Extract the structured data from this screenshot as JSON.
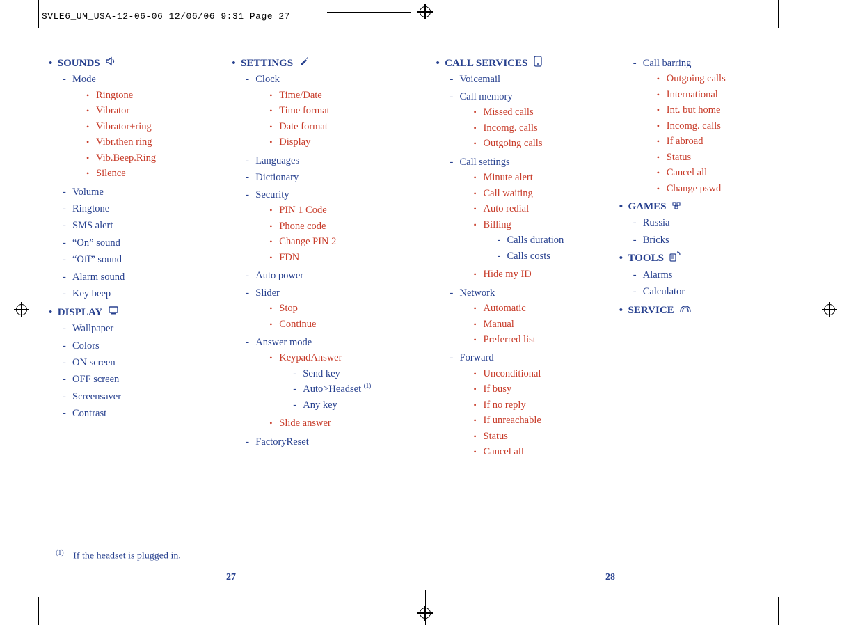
{
  "header_line": "SVLE6_UM_USA-12-06-06  12/06/06  9:31  Page 27",
  "footnote": {
    "marker": "(1)",
    "text": "If the headset is plugged in."
  },
  "page_num_left": "27",
  "page_num_right": "28",
  "menus": {
    "sounds": {
      "label": "SOUNDS",
      "mode": "Mode",
      "mode_items": [
        "Ringtone",
        "Vibrator",
        "Vibrator+ring",
        "Vibr.then ring",
        "Vib.Beep.Ring",
        "Silence"
      ],
      "extras": [
        "Volume",
        "Ringtone",
        "SMS alert",
        "“On” sound",
        "“Off” sound",
        "Alarm sound",
        "Key beep"
      ]
    },
    "display": {
      "label": "DISPLAY",
      "items": [
        "Wallpaper",
        "Colors",
        "ON screen",
        "OFF screen",
        "Screensaver",
        "Contrast"
      ]
    },
    "settings": {
      "label": "SETTINGS",
      "clock": {
        "label": "Clock",
        "items": [
          "Time/Date",
          "Time format",
          "Date format",
          "Display"
        ]
      },
      "languages": "Languages",
      "dictionary": "Dictionary",
      "security": {
        "label": "Security",
        "items": [
          "PIN 1 Code",
          "Phone code",
          "Change PIN 2",
          "FDN"
        ]
      },
      "auto_power": "Auto power",
      "slider": {
        "label": "Slider",
        "items": [
          "Stop",
          "Continue"
        ]
      },
      "answer_mode": {
        "label": "Answer mode",
        "keypad": {
          "label": "KeypadAnswer",
          "items": [
            "Send key",
            "Auto>Headset",
            "Any key"
          ],
          "fn_index": 1
        },
        "slide_answer": "Slide answer"
      },
      "factory_reset": "FactoryReset"
    },
    "call_services": {
      "label": "CALL SERVICES",
      "voicemail": "Voicemail",
      "call_memory": {
        "label": "Call memory",
        "items": [
          "Missed calls",
          "Incomg. calls",
          "Outgoing calls"
        ]
      },
      "call_settings": {
        "label": "Call settings",
        "items": [
          "Minute alert",
          "Call waiting",
          "Auto redial"
        ],
        "billing": {
          "label": "Billing",
          "items": [
            "Calls duration",
            "Calls costs"
          ]
        },
        "hide": "Hide my ID"
      },
      "network": {
        "label": "Network",
        "items": [
          "Automatic",
          "Manual",
          "Preferred list"
        ]
      },
      "forward": {
        "label": "Forward",
        "items": [
          "Unconditional",
          "If busy",
          "If no reply",
          "If unreachable",
          "Status",
          "Cancel all"
        ]
      }
    },
    "call_barring": {
      "label": "Call barring",
      "items": [
        "Outgoing calls",
        "International",
        "Int. but home",
        "Incomg. calls",
        "If abroad",
        "Status",
        "Cancel all",
        "Change pswd"
      ]
    },
    "games": {
      "label": "GAMES",
      "items": [
        "Russia",
        "Bricks"
      ]
    },
    "tools": {
      "label": "TOOLS",
      "items": [
        "Alarms",
        "Calculator"
      ]
    },
    "service": {
      "label": "SERVICE"
    }
  }
}
